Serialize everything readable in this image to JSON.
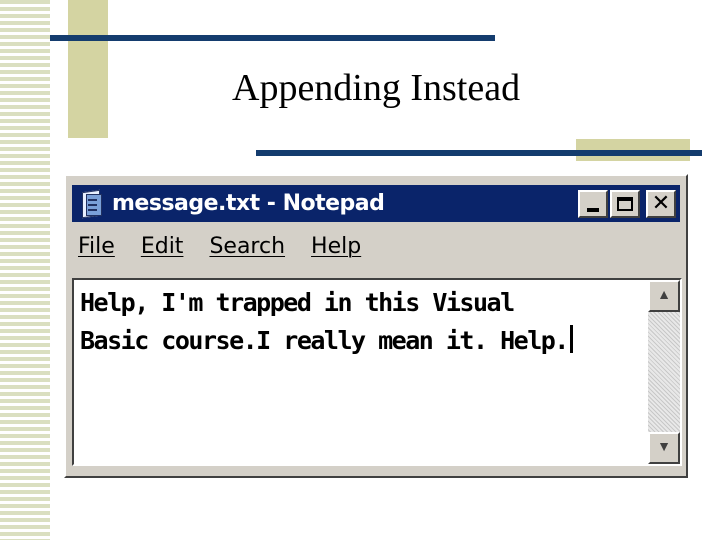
{
  "slide": {
    "title": "Appending Instead"
  },
  "window": {
    "title": "message.txt - Notepad",
    "icon": "notepad-icon",
    "controls": {
      "minimize_icon": "minimize-icon",
      "maximize_icon": "maximize-icon",
      "close_glyph": "✕"
    }
  },
  "menu": {
    "items": [
      {
        "label": "File"
      },
      {
        "label": "Edit"
      },
      {
        "label": "Search"
      },
      {
        "label": "Help"
      }
    ]
  },
  "editor": {
    "line1": "Help, I'm trapped in this Visual",
    "line2": "Basic course.I really mean it. Help."
  },
  "scrollbar": {
    "up_glyph": "▲",
    "down_glyph": "▼"
  },
  "colors": {
    "titlebar": "#0a246a",
    "rule": "#143c6e",
    "accent_beige": "#d4d4a2"
  }
}
